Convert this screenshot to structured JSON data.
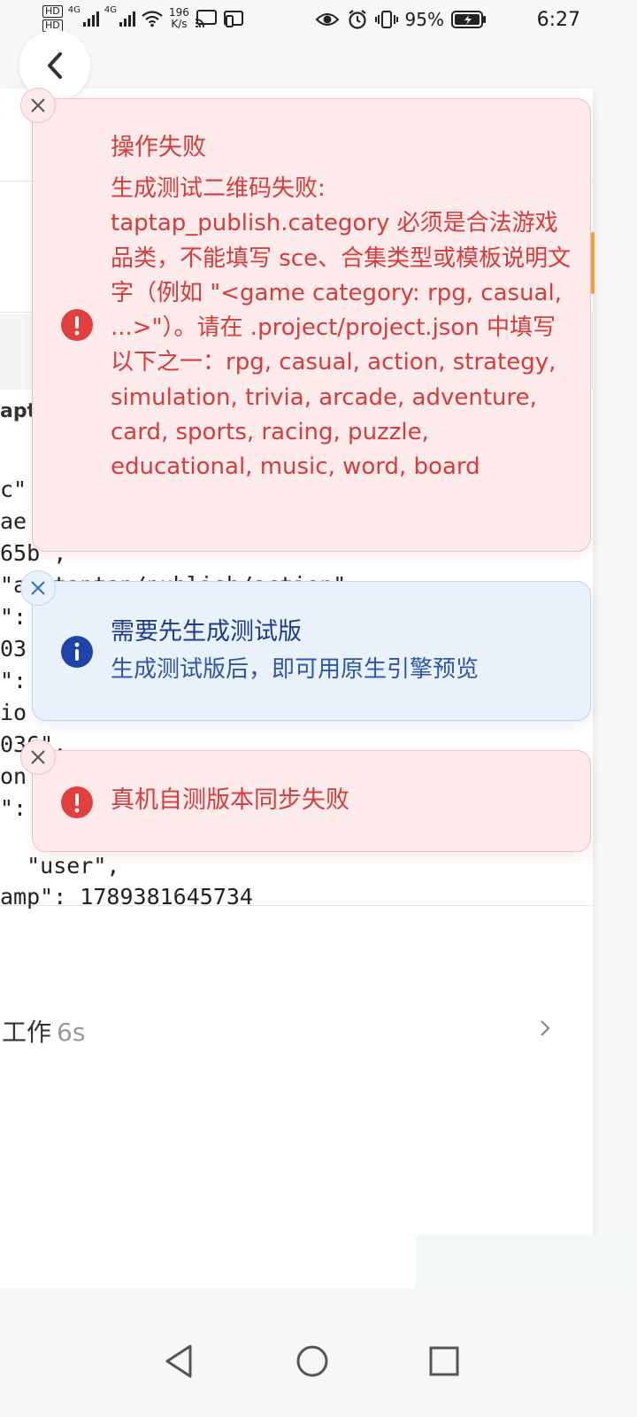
{
  "status_bar": {
    "hd1": "HD",
    "hd2": "HD",
    "net1": "4G",
    "net2": "4G",
    "speed_value": "196",
    "speed_unit": "K/s",
    "battery": "95%",
    "time": "6:27"
  },
  "toasts": {
    "error1": {
      "title": "操作失败",
      "message": "生成测试二维码失败: taptap_publish.category 必须是合法游戏品类，不能填写 sce、合集类型或模板说明文字（例如 \"<game category: rpg, casual, ...>\"）。请在 .project/project.json 中填写以下之一：rpg, casual, action, strategy, simulation, trivia, arcade, adventure, card, sports, racing, puzzle, educational, music, word, board"
    },
    "info": {
      "title": "需要先生成测试版",
      "message": "生成测试版后，即可用原生引擎预览"
    },
    "error2": {
      "title": "真机自测版本同步失败"
    }
  },
  "background": {
    "fragment_label": "apta",
    "code_lines": [
      "c\"",
      "ae",
      "65b\",",
      "\"ai.taptap/publish/action\"",
      "\":",
      "03",
      "\":",
      "io",
      "036\",",
      "on",
      "\":"
    ],
    "code_tail_1": "  \"user\",",
    "code_tail_2": "amp\": 1789381645734",
    "work_label": "工作",
    "work_time": "6s"
  },
  "colors": {
    "error": "#d73c3c",
    "info": "#1d3b8f",
    "error_bg": "#fdeaea",
    "info_bg": "#e9f2fb"
  }
}
